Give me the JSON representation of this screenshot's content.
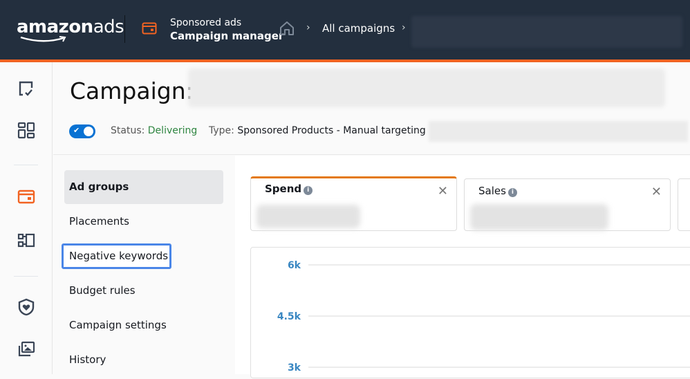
{
  "topbar": {
    "logo_bold": "amazon",
    "logo_light": "ads",
    "app_section": "Sponsored ads",
    "app_name": "Campaign manager",
    "breadcrumb": [
      {
        "label": "All campaigns"
      }
    ],
    "colors": {
      "bg": "#232f3e",
      "accent": "#f26322"
    }
  },
  "rail": {
    "items": [
      {
        "icon": "task-check-icon",
        "active": false
      },
      {
        "icon": "dashboard-grid-icon",
        "active": false
      },
      {
        "icon": "campaign-card-icon",
        "active": true
      },
      {
        "icon": "structure-icon",
        "active": false
      },
      {
        "icon": "brand-safety-shield-icon",
        "active": false
      },
      {
        "icon": "media-library-icon",
        "active": false
      }
    ]
  },
  "header": {
    "title_prefix": "Campaign:",
    "status_label": "Status:",
    "status_value": "Delivering",
    "type_label": "Type:",
    "type_value": "Sponsored Products - Manual targeting",
    "enabled": true
  },
  "subnav": {
    "items": [
      {
        "label": "Ad groups",
        "active": true
      },
      {
        "label": "Placements",
        "active": false
      },
      {
        "label": "Negative keywords",
        "active": false,
        "focused": true
      },
      {
        "label": "Budget rules",
        "active": false
      },
      {
        "label": "Campaign settings",
        "active": false
      },
      {
        "label": "History",
        "active": false
      }
    ]
  },
  "metrics": {
    "cards": [
      {
        "label": "Spend",
        "selected": true
      },
      {
        "label": "Sales",
        "selected": false
      }
    ],
    "info_glyph": "i",
    "close_glyph": "✕"
  },
  "chart_data": {
    "type": "line",
    "title": "",
    "xlabel": "",
    "ylabel": "",
    "y_ticks": [
      "6k",
      "4.5k",
      "3k"
    ],
    "y_tick_values": [
      6000,
      4500,
      3000
    ],
    "series": [],
    "grid": true
  }
}
